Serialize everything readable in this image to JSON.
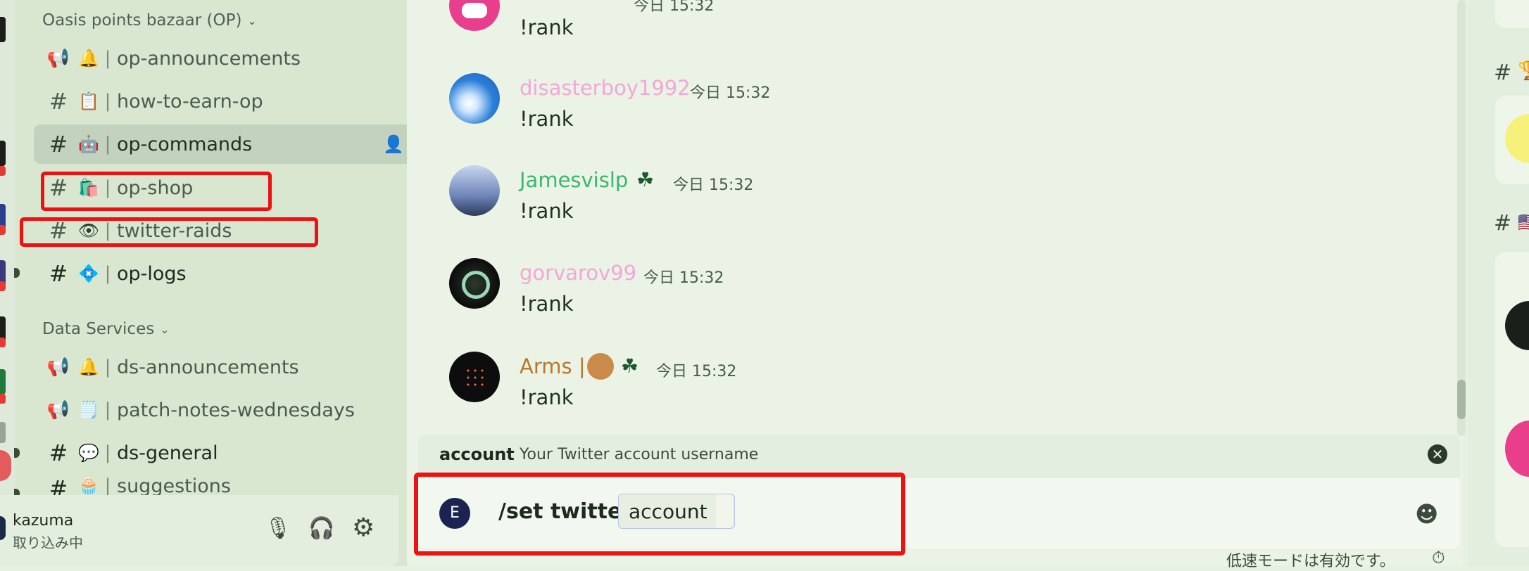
{
  "sidebar": {
    "categories": [
      {
        "label": "Oasis points bazaar (OP)"
      },
      {
        "label": "Data Services"
      }
    ],
    "channels": [
      {
        "emoji": "🔔",
        "name": "op-announcements"
      },
      {
        "emoji": "📋",
        "name": "how-to-earn-op"
      },
      {
        "emoji": "🤖",
        "name": "op-commands"
      },
      {
        "emoji": "🛍️",
        "name": "op-shop"
      },
      {
        "emoji": "👁",
        "name": "twitter-raids"
      },
      {
        "emoji": "💠",
        "name": "op-logs"
      },
      {
        "emoji": "🔔",
        "name": "ds-announcements"
      },
      {
        "emoji": "🗒️",
        "name": "patch-notes-wednesdays"
      },
      {
        "emoji": "💬",
        "name": "ds-general"
      },
      {
        "emoji": "🧁",
        "name": "suggestions"
      }
    ]
  },
  "user_panel": {
    "username": "kazuma",
    "status": "取り込み中"
  },
  "messages": [
    {
      "author": "",
      "timestamp": "今日 15:32",
      "body": "!rank",
      "color": "#e83e8c"
    },
    {
      "author": "disasterboy1992",
      "timestamp": "今日 15:32",
      "body": "!rank",
      "color": "#f4a7d6"
    },
    {
      "author": "Jamesvislp",
      "timestamp": "今日 15:32",
      "body": "!rank",
      "color": "#3ab86b"
    },
    {
      "author": "gorvarov99",
      "timestamp": "今日 15:32",
      "body": "!rank",
      "color": "#f4a7d6"
    },
    {
      "author": "Arms |",
      "timestamp": "今日 15:32",
      "body": "!rank",
      "color": "#b47a2a"
    }
  ],
  "autocomplete": {
    "option_name": "account",
    "option_desc": "Your Twitter account username"
  },
  "composer": {
    "command": "/set twitter",
    "param": "account"
  },
  "footer": {
    "slowmode_text": "低速モードは有効です。"
  },
  "colors": {
    "highlight_red": "#ee1111",
    "sidebar_bg": "#d9e7d1",
    "chat_bg": "#eaf3e5"
  }
}
